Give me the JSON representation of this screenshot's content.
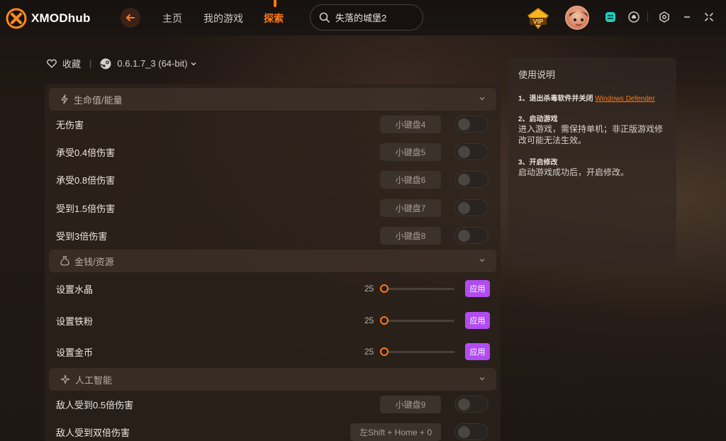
{
  "app": {
    "brand": "XMODhub"
  },
  "nav": {
    "home": "主页",
    "my_games": "我的游戏",
    "explore": "探索"
  },
  "search": {
    "value": "失落的城堡2"
  },
  "meta": {
    "favorite": "收藏",
    "separator": "|",
    "version": "0.6.1.7_3 (64-bit)"
  },
  "sections": [
    {
      "title": "生命值/能量",
      "icon": "lightning-icon",
      "rows": [
        {
          "label": "无伤害",
          "hotkey": "小键盘4",
          "enabled": false
        },
        {
          "label": "承受0.4倍伤害",
          "hotkey": "小键盘5",
          "enabled": false
        },
        {
          "label": "承受0.8倍伤害",
          "hotkey": "小键盘6",
          "enabled": false
        },
        {
          "label": "受到1.5倍伤害",
          "hotkey": "小键盘7",
          "enabled": false
        },
        {
          "label": "受到3倍伤害",
          "hotkey": "小键盘8",
          "enabled": false
        }
      ]
    },
    {
      "title": "金钱/资源",
      "icon": "money-bag-icon",
      "rows": [
        {
          "label": "设置水晶",
          "value": "25",
          "action": "应用"
        },
        {
          "label": "设置铁粉",
          "value": "25",
          "action": "应用"
        },
        {
          "label": "设置金币",
          "value": "25",
          "action": "应用"
        }
      ]
    },
    {
      "title": "人工智能",
      "icon": "sparkle-icon",
      "rows": [
        {
          "label": "敌人受到0.5倍伤害",
          "hotkey": "小键盘9",
          "enabled": false
        },
        {
          "label": "敌人受到双倍伤害",
          "hotkey": "左Shift + Home + 0",
          "enabled": false
        }
      ]
    }
  ],
  "help": {
    "title": "使用说明",
    "step1_title": "1、退出杀毒软件并关闭",
    "step1_link": "Windows Defender",
    "step2_title": "2、启动游戏",
    "step2_body": "进入游戏，需保持单机；非正版游戏修改可能无法生效。",
    "step3_title": "3、开启修改",
    "step3_body": "启动游戏成功后，开启修改。"
  },
  "colors": {
    "accent": "#ff7a1a",
    "apply": "#b14cf0",
    "vip_gold": "#f5b520",
    "status_teal": "#1fd0c0"
  }
}
